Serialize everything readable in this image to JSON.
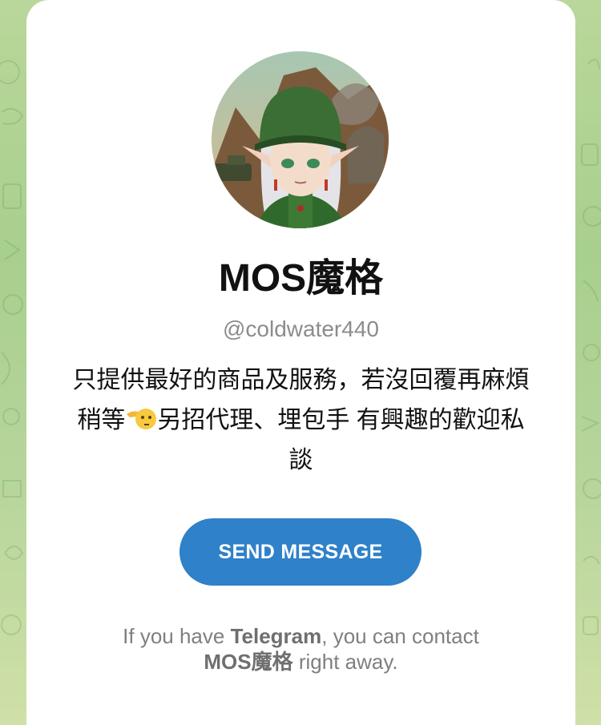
{
  "profile": {
    "name": "MOS魔格",
    "username": "@coldwater440",
    "bio_line1": "只提供最好的商品及服務，若沒回覆再麻煩",
    "bio_line2_before": "稍等",
    "bio_emoji": "pointing-left-face-emoji",
    "bio_line2_after": "另招代理、埋包手 有興趣的歡迎私",
    "bio_line3": "談"
  },
  "actions": {
    "send_message_label": "SEND MESSAGE"
  },
  "footer": {
    "prefix": "If you have ",
    "app_name": "Telegram",
    "middle": ", you can contact",
    "contact_name": "MOS魔格",
    "suffix": " right away."
  },
  "colors": {
    "button": "#2f81c9",
    "background_green": "#a8cf8e",
    "card": "#ffffff"
  }
}
